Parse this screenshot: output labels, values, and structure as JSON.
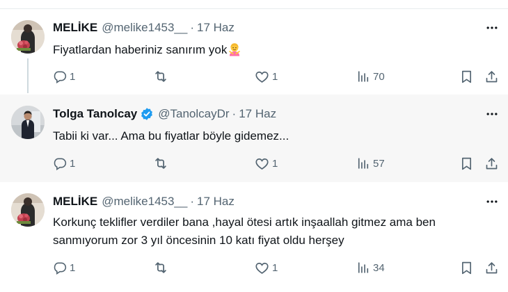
{
  "tweets": [
    {
      "name": "MELİKE",
      "handle": "@melike1453__",
      "separator": "·",
      "date": "17 Haz",
      "text": "Fiyatlardan haberiniz sanırım yok",
      "emoji": "woman-gesturing-icon",
      "replies": "1",
      "retweets": "",
      "likes": "1",
      "views": "70",
      "verified": false
    },
    {
      "name": "Tolga Tanolcay",
      "handle": "@TanolcayDr",
      "separator": "·",
      "date": "17 Haz",
      "text": "Tabii ki var... Ama bu fiyatlar böyle gidemez...",
      "replies": "1",
      "retweets": "",
      "likes": "1",
      "views": "57",
      "verified": true
    },
    {
      "name": "MELİKE",
      "handle": "@melike1453__",
      "separator": "·",
      "date": "17 Haz",
      "text_line1": "Korkunç teklifler verdiler bana ,hayal ötesi artık inşaallah gitmez ama ben",
      "text_line2": "sanmıyorum zor 3 yıl öncesinin 10 katı fiyat oldu herşey",
      "replies": "1",
      "retweets": "",
      "likes": "1",
      "views": "34",
      "verified": false
    }
  ],
  "colors": {
    "text": "#0f1419",
    "secondary": "#536471",
    "verified": "#1d9bf0",
    "thread_line": "#cfd9de",
    "highlight_bg": "#f7f7f7"
  }
}
